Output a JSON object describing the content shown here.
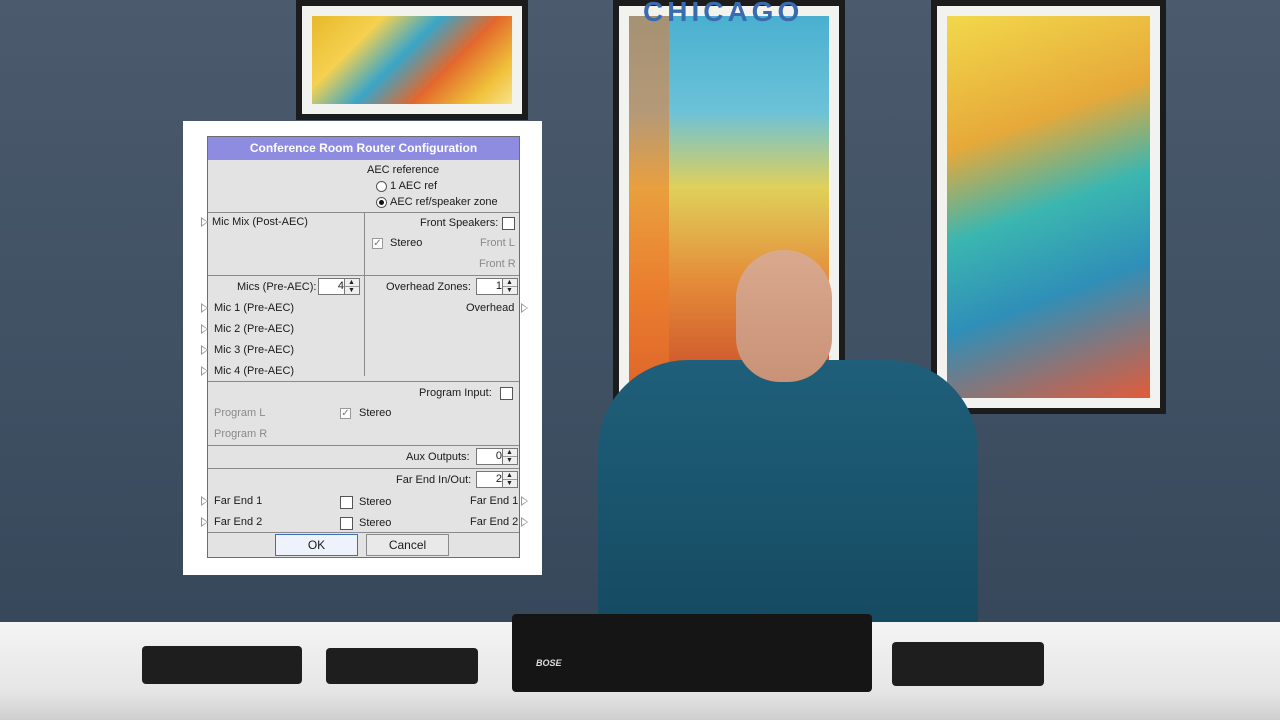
{
  "scene": {
    "poster_center_text": "CHICAGO",
    "device_brand": "BOSE"
  },
  "dialog": {
    "title": "Conference Room Router Configuration",
    "aec": {
      "label": "AEC reference",
      "options": [
        "1 AEC ref",
        "AEC ref/speaker zone"
      ],
      "selected_index": 1
    },
    "mic_mix_label": "Mic Mix (Post-AEC)",
    "front_speakers": {
      "label": "Front Speakers:",
      "checked": false,
      "stereo_label": "Stereo",
      "stereo_checked": true,
      "outputs": [
        "Front L",
        "Front R"
      ]
    },
    "mics": {
      "label": "Mics (Pre-AEC):",
      "count": "4",
      "items": [
        "Mic 1 (Pre-AEC)",
        "Mic 2 (Pre-AEC)",
        "Mic 3 (Pre-AEC)",
        "Mic 4 (Pre-AEC)"
      ]
    },
    "overhead": {
      "label": "Overhead Zones:",
      "count": "1",
      "output": "Overhead"
    },
    "program": {
      "label": "Program Input:",
      "checked": false,
      "inputs": [
        "Program L",
        "Program R"
      ],
      "stereo_label": "Stereo",
      "stereo_checked": true
    },
    "aux": {
      "label": "Aux Outputs:",
      "count": "0"
    },
    "far_end": {
      "label": "Far End In/Out:",
      "count": "2",
      "inputs": [
        "Far End 1",
        "Far End 2"
      ],
      "stereo_label": "Stereo",
      "outputs": [
        "Far End 1",
        "Far End 2"
      ]
    },
    "buttons": {
      "ok": "OK",
      "cancel": "Cancel"
    }
  }
}
